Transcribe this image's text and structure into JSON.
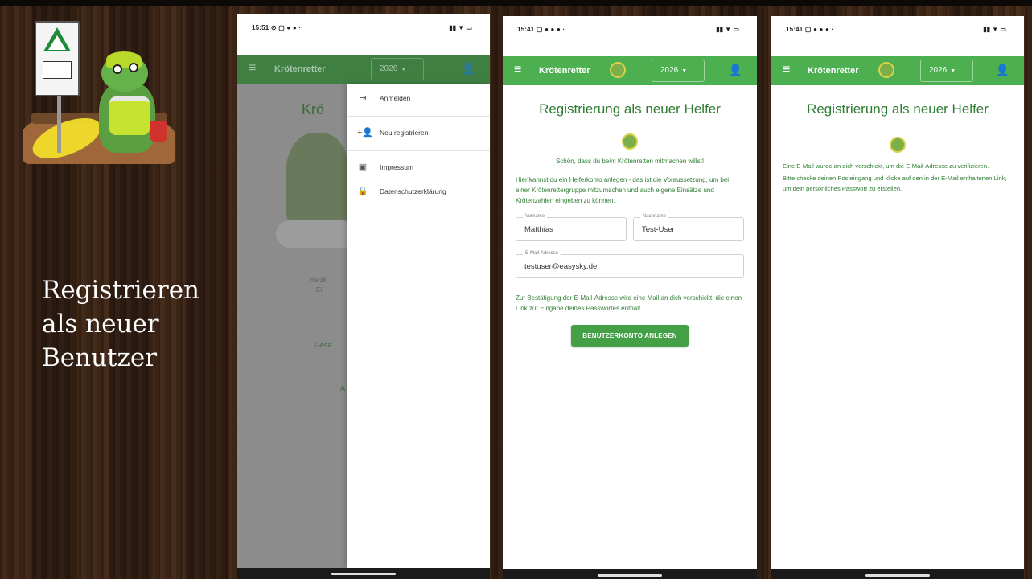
{
  "slide": {
    "title_lines": [
      "Registrieren",
      "als neuer",
      "Benutzer"
    ]
  },
  "colors": {
    "app_green": "#4caf50",
    "text_green": "#2e7d32",
    "button_green": "#43a047"
  },
  "phone1": {
    "status_time": "15:51",
    "status_icons": "⊘ ▢ ● ● ·",
    "sys_icons": "▮▮ ▼ ▭",
    "appbar": {
      "title": "Krötenretter",
      "year": "2026"
    },
    "background": {
      "title": "Krö",
      "text1": "Herzli",
      "text2": "Ei",
      "green1": "Gesa",
      "green2": "A"
    },
    "drawer": [
      {
        "label": "Anmelden",
        "icon": "login-icon"
      },
      {
        "label": "Neu registrieren",
        "icon": "person-add-icon"
      },
      {
        "label": "Impressum",
        "icon": "info-box-icon"
      },
      {
        "label": "Datenschutzerklärung",
        "icon": "lock-icon"
      }
    ]
  },
  "phone2": {
    "status_time": "15:41",
    "status_icons": "▢ ● ● ● ·",
    "sys_icons": "▮▮ ▼ ▭",
    "appbar": {
      "title": "Krötenretter",
      "year": "2026"
    },
    "page_title": "Registrierung als neuer Helfer",
    "welcome": "Schön, dass du beim Krötenretten mitmachen willst!",
    "intro": "Hier kannst du ein Helferkonto anlegen - das ist die Voraussetzung, um bei einer Krötenrettergruppe mitzumachen und auch eigene Einsätze und Krötenzahlen eingeben zu können.",
    "form": {
      "firstname_label": "Vorname",
      "firstname_value": "Matthias",
      "lastname_label": "Nachname",
      "lastname_value": "Test-User",
      "email_label": "E-Mail-Adresse",
      "email_value": "testuser@easysky.de"
    },
    "confirm_note": "Zur Bestätigung der E-Mail-Adresse wird eine Mail an dich verschickt, die einen Link zur Eingabe deines Passwortes enthält.",
    "submit_label": "BENUTZERKONTO ANLEGEN"
  },
  "phone3": {
    "status_time": "15:41",
    "status_icons": "▢ ● ● ● ·",
    "sys_icons": "▮▮ ▼ ▭",
    "appbar": {
      "title": "Krötenretter",
      "year": "2026"
    },
    "page_title": "Registrierung als neuer Helfer",
    "info1": "Eine E-Mail wurde an dich verschickt, um die E-Mail-Adresse zu verifizieren.",
    "info2": "Bitte checke deinen Posteingang und klicke auf den in der E-Mail enthaltenen Link, um dein persönliches Passwort zu erstellen."
  }
}
